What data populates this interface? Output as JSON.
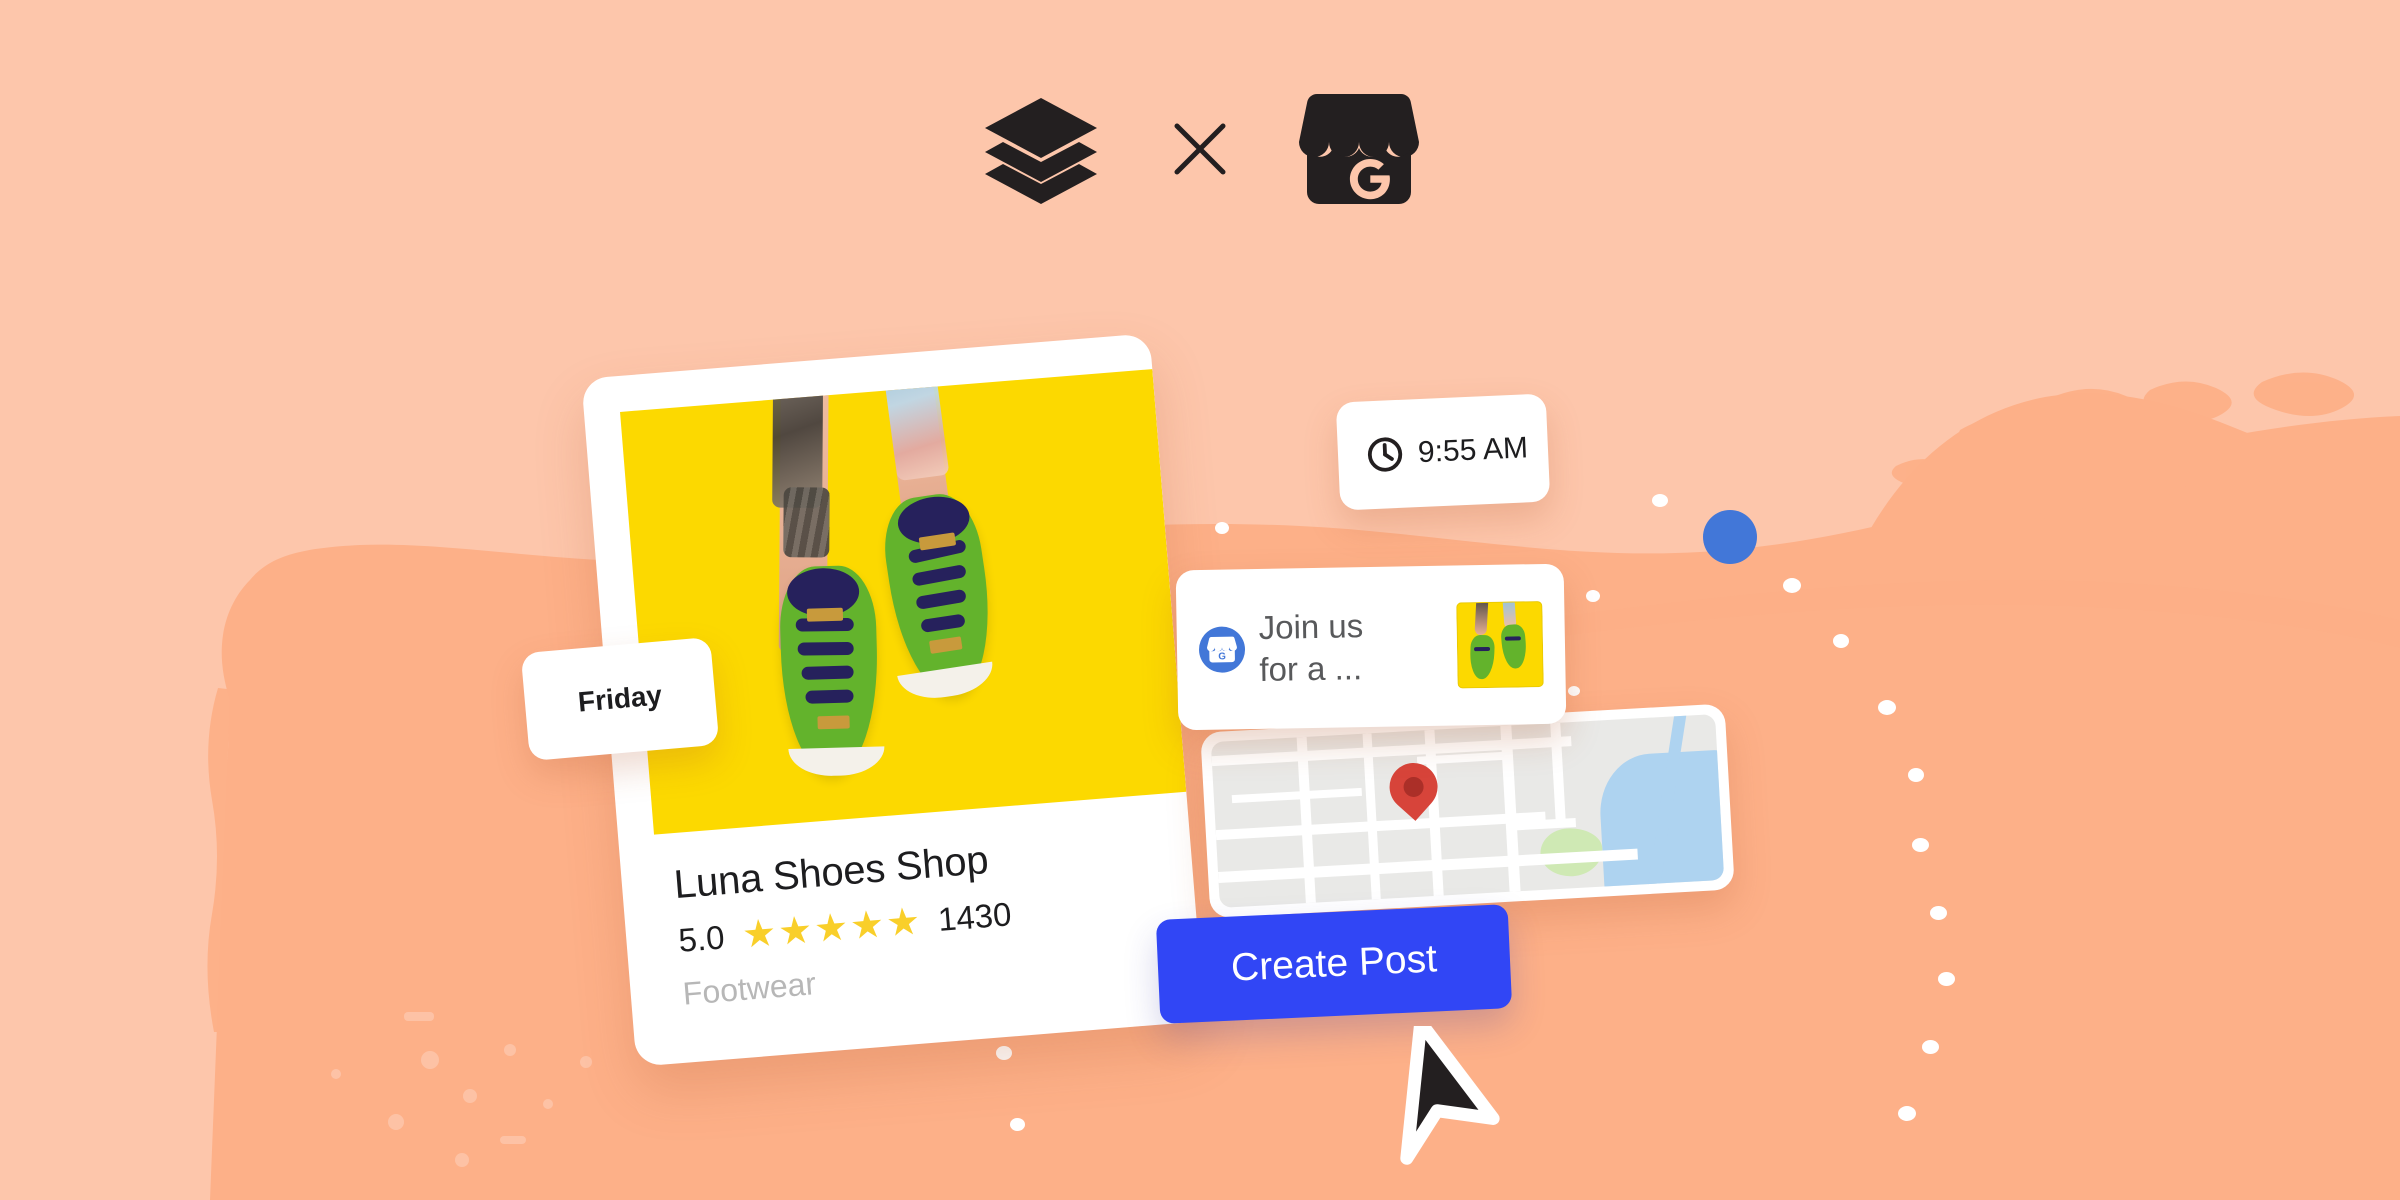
{
  "header": {
    "buffer_logo_alt": "Buffer",
    "separator": "×",
    "google_business_logo_alt": "Google Business Profile"
  },
  "colors": {
    "background_light": "#FDC6AB",
    "background_brush": "#FDB088",
    "accent_blue": "#3146F5",
    "avatar_blue": "#4277D8",
    "photo_yellow": "#FCD900",
    "star_yellow": "#F9CF2A",
    "map_pin_red": "#D7443A",
    "ink": "#1D1D1F",
    "muted": "#B7B7B7"
  },
  "business_card": {
    "name": "Luna Shoes Shop",
    "rating_value": "5.0",
    "stars": [
      "★",
      "★",
      "★",
      "★",
      "★"
    ],
    "star_count": 5,
    "review_count": "1430",
    "category": "Footwear",
    "photo_alt": "green-sneakers-on-yellow-background"
  },
  "chips": {
    "day_label": "Friday",
    "time_label": "9:55 AM",
    "clock_icon": "clock-icon"
  },
  "post_preview": {
    "avatar_icon": "google-business-storefront-icon",
    "text": "Join us\nfor a ...",
    "thumbnail_alt": "green-sneakers-thumbnail"
  },
  "map": {
    "pin_icon": "map-pin-icon",
    "alt": "street-map-with-location-pin"
  },
  "cta": {
    "label": "Create Post"
  },
  "cursor": {
    "icon": "mouse-pointer-icon"
  }
}
